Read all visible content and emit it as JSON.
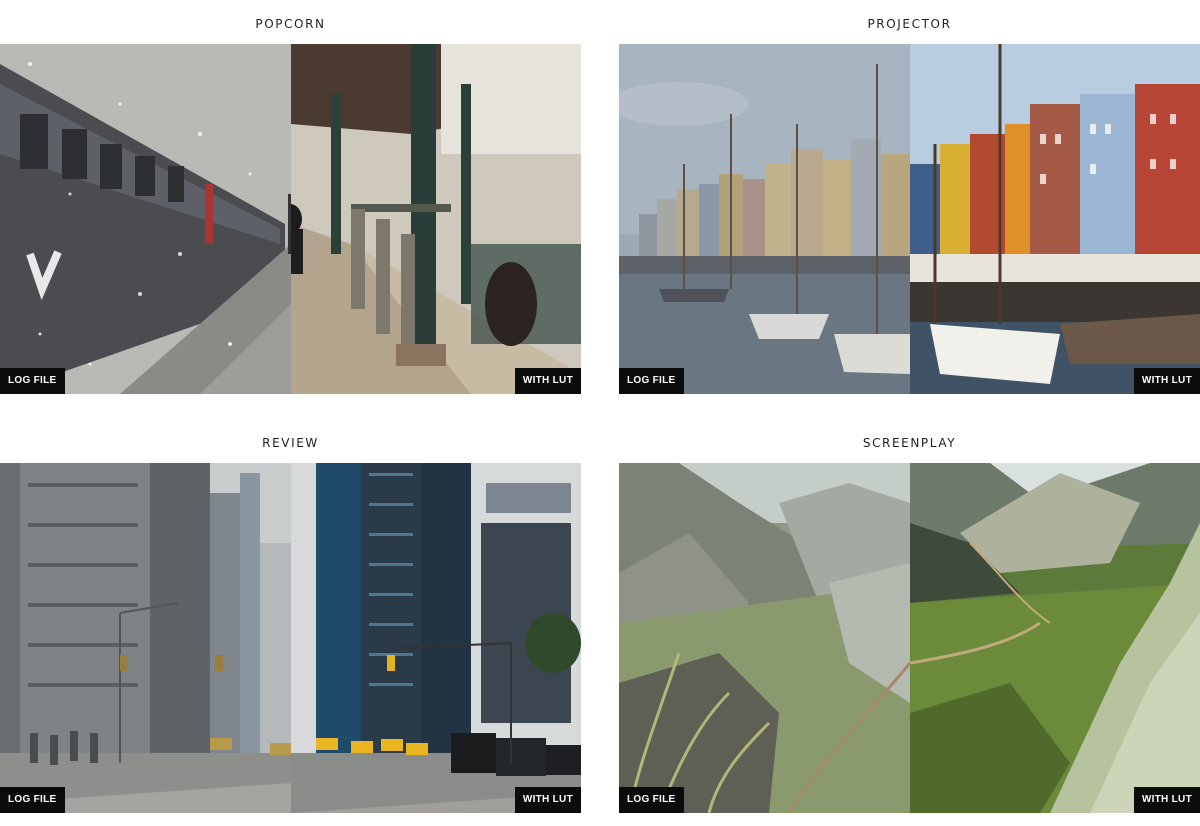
{
  "cards": [
    {
      "title": "POPCORN",
      "before_label": "LOG FILE",
      "after_label": "WITH LUT"
    },
    {
      "title": "PROJECTOR",
      "before_label": "LOG FILE",
      "after_label": "WITH LUT"
    },
    {
      "title": "REVIEW",
      "before_label": "LOG FILE",
      "after_label": "WITH LUT"
    },
    {
      "title": "SCREENPLAY",
      "before_label": "LOG FILE",
      "after_label": "WITH LUT"
    }
  ]
}
